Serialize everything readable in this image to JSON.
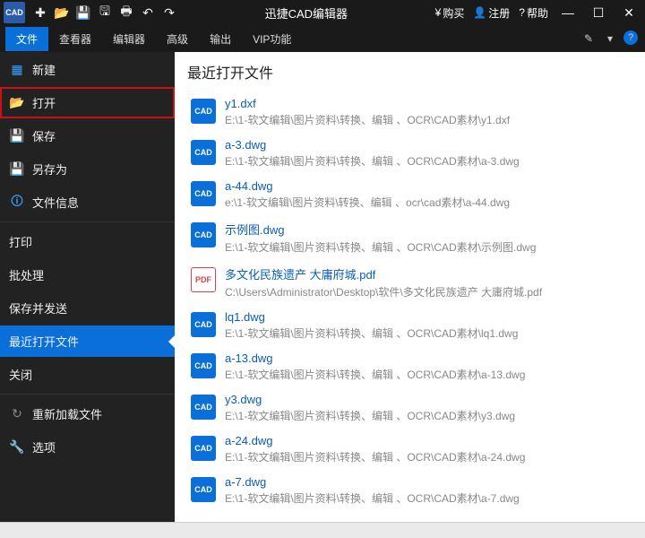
{
  "title": "迅捷CAD编辑器",
  "titlebar_right": {
    "buy": "购买",
    "register": "注册",
    "help": "帮助"
  },
  "menubar": [
    "文件",
    "查看器",
    "编辑器",
    "高级",
    "输出",
    "VIP功能"
  ],
  "sidebar": [
    {
      "label": "新建",
      "icon": "▦",
      "mode": "normal"
    },
    {
      "label": "打开",
      "icon": "📂",
      "mode": "highlight"
    },
    {
      "label": "保存",
      "icon": "💾",
      "mode": "normal"
    },
    {
      "label": "另存为",
      "icon": "💾",
      "mode": "normal"
    },
    {
      "label": "文件信息",
      "icon": "🛈",
      "mode": "normal"
    },
    {
      "label": "打印",
      "icon": "",
      "mode": "plain"
    },
    {
      "label": "批处理",
      "icon": "",
      "mode": "plain"
    },
    {
      "label": "保存并发送",
      "icon": "",
      "mode": "plain"
    },
    {
      "label": "最近打开文件",
      "icon": "",
      "mode": "selected"
    },
    {
      "label": "关闭",
      "icon": "",
      "mode": "plain"
    },
    {
      "label": "重新加载文件",
      "icon": "↻",
      "mode": "grey"
    },
    {
      "label": "选项",
      "icon": "🔧",
      "mode": "grey"
    }
  ],
  "main_heading": "最近打开文件",
  "files": [
    {
      "name": "y1.dxf",
      "path": "E:\\1-软文编辑\\图片资料\\转换、编辑 、OCR\\CAD素材\\y1.dxf",
      "type": "cad"
    },
    {
      "name": "a-3.dwg",
      "path": "E:\\1-软文编辑\\图片资料\\转换、编辑 、OCR\\CAD素材\\a-3.dwg",
      "type": "cad"
    },
    {
      "name": "a-44.dwg",
      "path": "e:\\1-软文编辑\\图片资料\\转换、编辑 、ocr\\cad素材\\a-44.dwg",
      "type": "cad"
    },
    {
      "name": "示例图.dwg",
      "path": "E:\\1-软文编辑\\图片资料\\转换、编辑 、OCR\\CAD素材\\示例图.dwg",
      "type": "cad"
    },
    {
      "name": "多文化民族遗产 大庸府城.pdf",
      "path": "C:\\Users\\Administrator\\Desktop\\软件\\多文化民族遗产 大庸府城.pdf",
      "type": "pdf"
    },
    {
      "name": "lq1.dwg",
      "path": "E:\\1-软文编辑\\图片资料\\转换、编辑 、OCR\\CAD素材\\lq1.dwg",
      "type": "cad"
    },
    {
      "name": "a-13.dwg",
      "path": "E:\\1-软文编辑\\图片资料\\转换、编辑 、OCR\\CAD素材\\a-13.dwg",
      "type": "cad"
    },
    {
      "name": "y3.dwg",
      "path": "E:\\1-软文编辑\\图片资料\\转换、编辑 、OCR\\CAD素材\\y3.dwg",
      "type": "cad"
    },
    {
      "name": "a-24.dwg",
      "path": "E:\\1-软文编辑\\图片资料\\转换、编辑 、OCR\\CAD素材\\a-24.dwg",
      "type": "cad"
    },
    {
      "name": "a-7.dwg",
      "path": "E:\\1-软文编辑\\图片资料\\转换、编辑 、OCR\\CAD素材\\a-7.dwg",
      "type": "cad"
    }
  ]
}
